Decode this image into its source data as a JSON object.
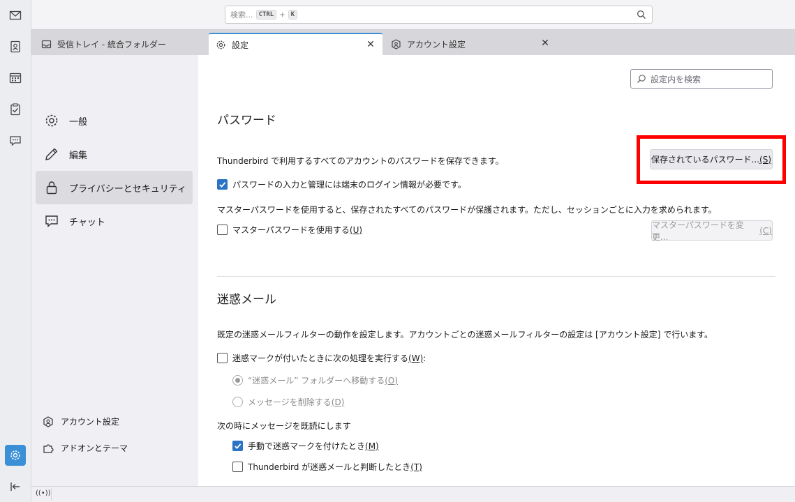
{
  "spaces": {
    "items": [
      "mail-icon",
      "address-book-icon",
      "calendar-icon",
      "tasks-icon",
      "chat-icon"
    ],
    "settings_icon": "gear-icon",
    "collapse_icon": "collapse-icon"
  },
  "search": {
    "placeholder": "検索...",
    "key1": "CTRL",
    "plus": "+",
    "key2": "K"
  },
  "tabs": [
    {
      "label": "受信トレイ - 統合フォルダー",
      "icon": "inbox-icon",
      "selected": false
    },
    {
      "label": "設定",
      "icon": "gear-icon",
      "selected": true,
      "close": "✕"
    },
    {
      "label": "アカウント設定",
      "icon": "account-icon",
      "selected": false,
      "close": "✕"
    }
  ],
  "sidebar": {
    "categories": [
      {
        "label": "一般",
        "icon": "gear-icon"
      },
      {
        "label": "編集",
        "icon": "pencil-icon"
      },
      {
        "label": "プライバシーとセキュリティ",
        "icon": "lock-icon",
        "selected": true
      },
      {
        "label": "チャット",
        "icon": "chat-icon"
      }
    ],
    "footer": [
      {
        "label": "アカウント設定",
        "icon": "account-icon"
      },
      {
        "label": "アドオンとテーマ",
        "icon": "puzzle-icon"
      }
    ]
  },
  "main": {
    "search_placeholder": "設定内を検索",
    "password": {
      "heading": "パスワード",
      "description": "Thunderbird で利用するすべてのアカウントのパスワードを保存できます。",
      "saved_passwords_btn": "保存されているパスワード...",
      "saved_passwords_key": "(S)",
      "os_auth_label": "パスワードの入力と管理には端末のログイン情報が必要です。",
      "os_auth_checked": true,
      "master_desc": "マスターパスワードを使用すると、保存されたすべてのパスワードが保護されます。ただし、セッションごとに入力を求められます。",
      "use_master_label": "マスターパスワードを使用する",
      "use_master_key": "(U)",
      "use_master_checked": false,
      "change_master_btn": "マスターパスワードを変更...",
      "change_master_key": "(C)"
    },
    "junk": {
      "heading": "迷惑メール",
      "description": "既定の迷惑メールフィルターの動作を設定します。アカウントごとの迷惑メールフィルターの設定は [アカウント設定] で行います。",
      "action_label": "迷惑マークが付いたときに次の処理を実行する",
      "action_key": "(W)",
      "action_checked": false,
      "move_label": "“迷惑メール” フォルダーへ移動する",
      "move_key": "(O)",
      "delete_label": "メッセージを削除する",
      "delete_key": "(D)",
      "mark_read_heading": "次の時にメッセージを既読にします",
      "manual_label": "手動で迷惑マークを付けたとき",
      "manual_key": "(M)",
      "manual_checked": true,
      "auto_label": "Thunderbird が迷惑メールと判断したとき",
      "auto_key": "(T)",
      "auto_checked": false
    }
  },
  "status": {
    "signal": "((•))"
  },
  "colors": {
    "accent": "#2a73c5",
    "highlight": "#ff0000",
    "active_space": "#3a8fd6"
  }
}
